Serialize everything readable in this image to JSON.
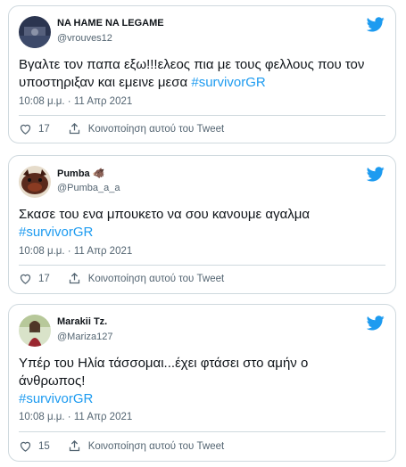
{
  "colors": {
    "accent": "#1d9bf0",
    "muted": "#536471",
    "border": "#cfd9de"
  },
  "tweets": [
    {
      "name": "NA HAME NA LEGAME",
      "handle": "@vrouves12",
      "text_line1": "Βγαλτε τον παπα εξω!!!ελεος πια με τους φελλους που τον",
      "text_line2": "υποστηριξαν και εμεινε μεσα ",
      "hashtag": "#survivorGR",
      "time": "10:08 μ.μ. · 11 Απρ 2021",
      "likes": "17",
      "share": "Κοινοποίηση αυτού του Tweet"
    },
    {
      "name": "Pumba",
      "name_emoji": "🐗",
      "handle": "@Pumba_a_a",
      "text_line1": "Σκασε του ενα μπουκετο να σου κανουμε αγαλμα",
      "hashtag": "#survivorGR",
      "time": "10:08 μ.μ. · 11 Απρ 2021",
      "likes": "17",
      "share": "Κοινοποίηση αυτού του Tweet"
    },
    {
      "name": "Marakii Tz.",
      "handle": "@Mariza127",
      "text_line1": "Υπέρ του Ηλία τάσσομαι...έχει φτάσει στο αμήν ο",
      "text_line2": "άνθρωπος!",
      "hashtag": "#survivorGR",
      "time": "10:08 μ.μ. · 11 Απρ 2021",
      "likes": "15",
      "share": "Κοινοποίηση αυτού του Tweet"
    }
  ]
}
